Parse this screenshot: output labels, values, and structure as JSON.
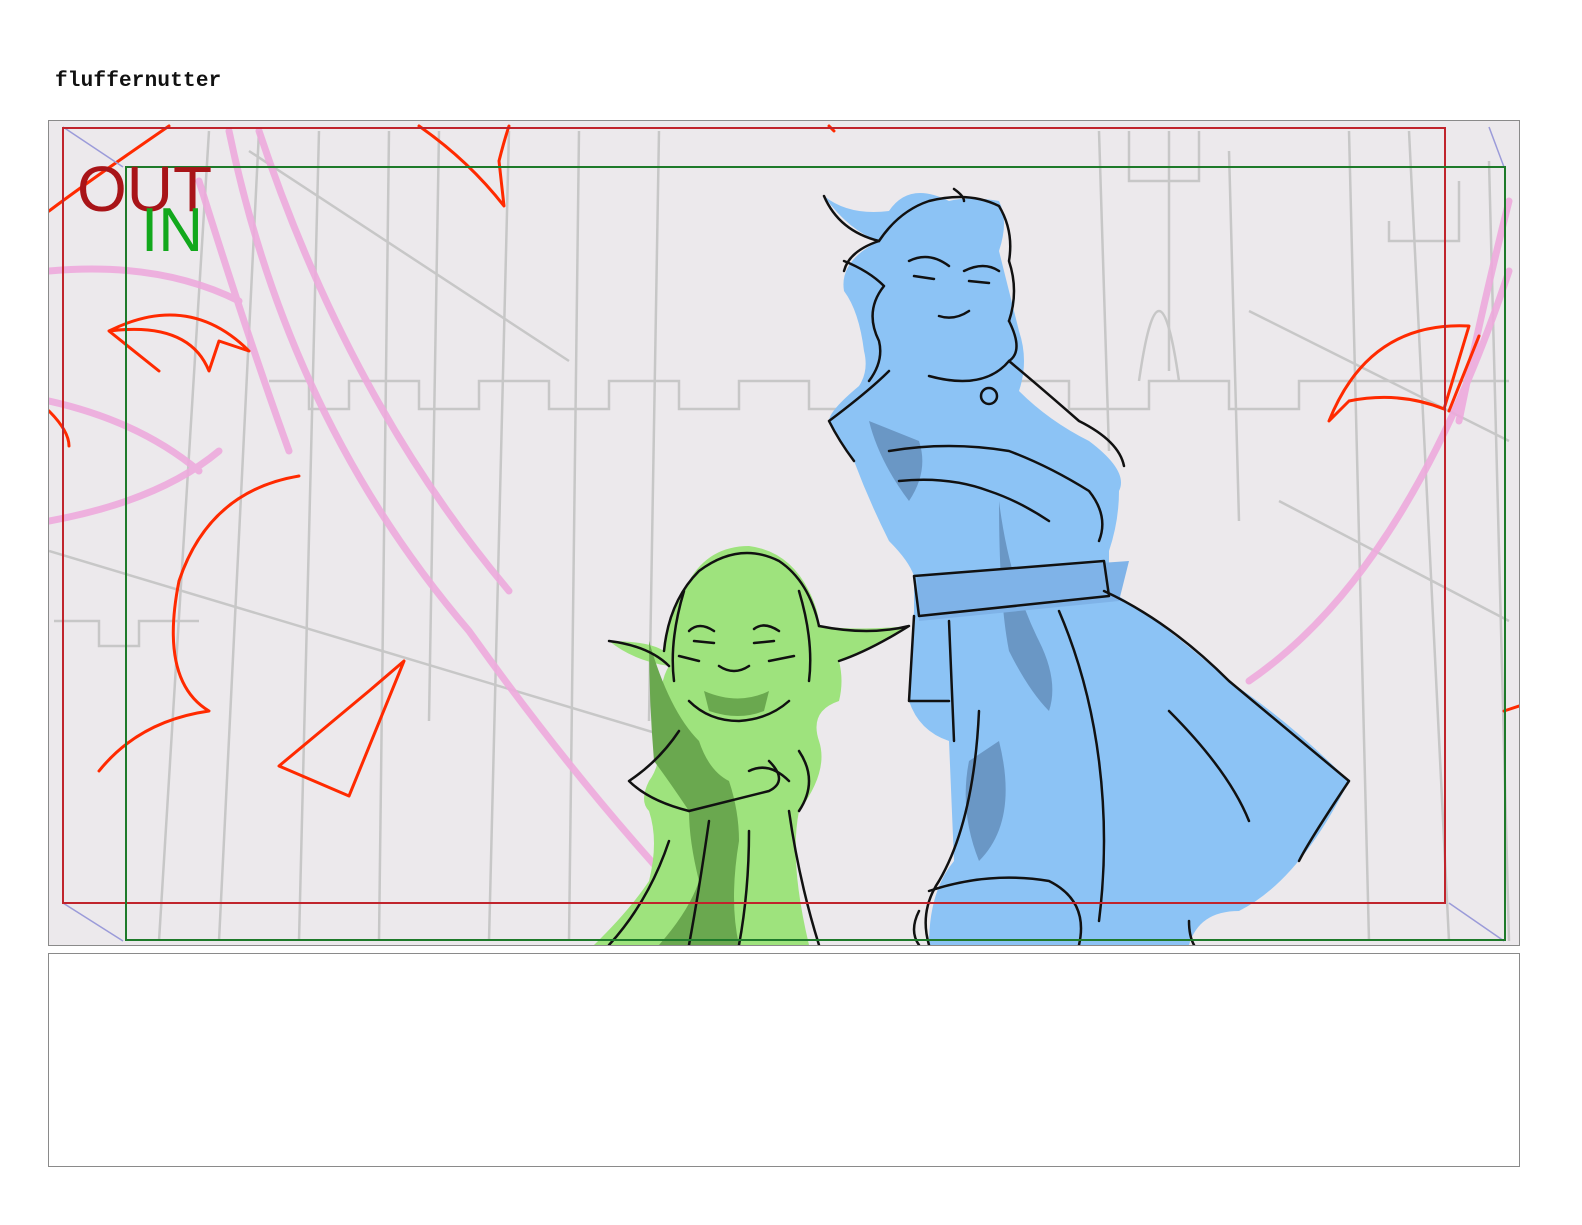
{
  "board": {
    "title": "fluffernutter",
    "notes": ""
  },
  "panel": {
    "out_label": "OUT",
    "in_label": "IN",
    "colors": {
      "background": "#ece9ec",
      "out_frame": "#c0242c",
      "in_frame": "#1e7a2a",
      "out_text": "#a81418",
      "in_text": "#12a81c",
      "arrows": "#ff2a00",
      "magic": "#eeaadd",
      "bg_lines": "#c7c7c7",
      "green_character": "#9ee37d",
      "blue_character": "#8cc3f5",
      "ink": "#111111"
    }
  }
}
